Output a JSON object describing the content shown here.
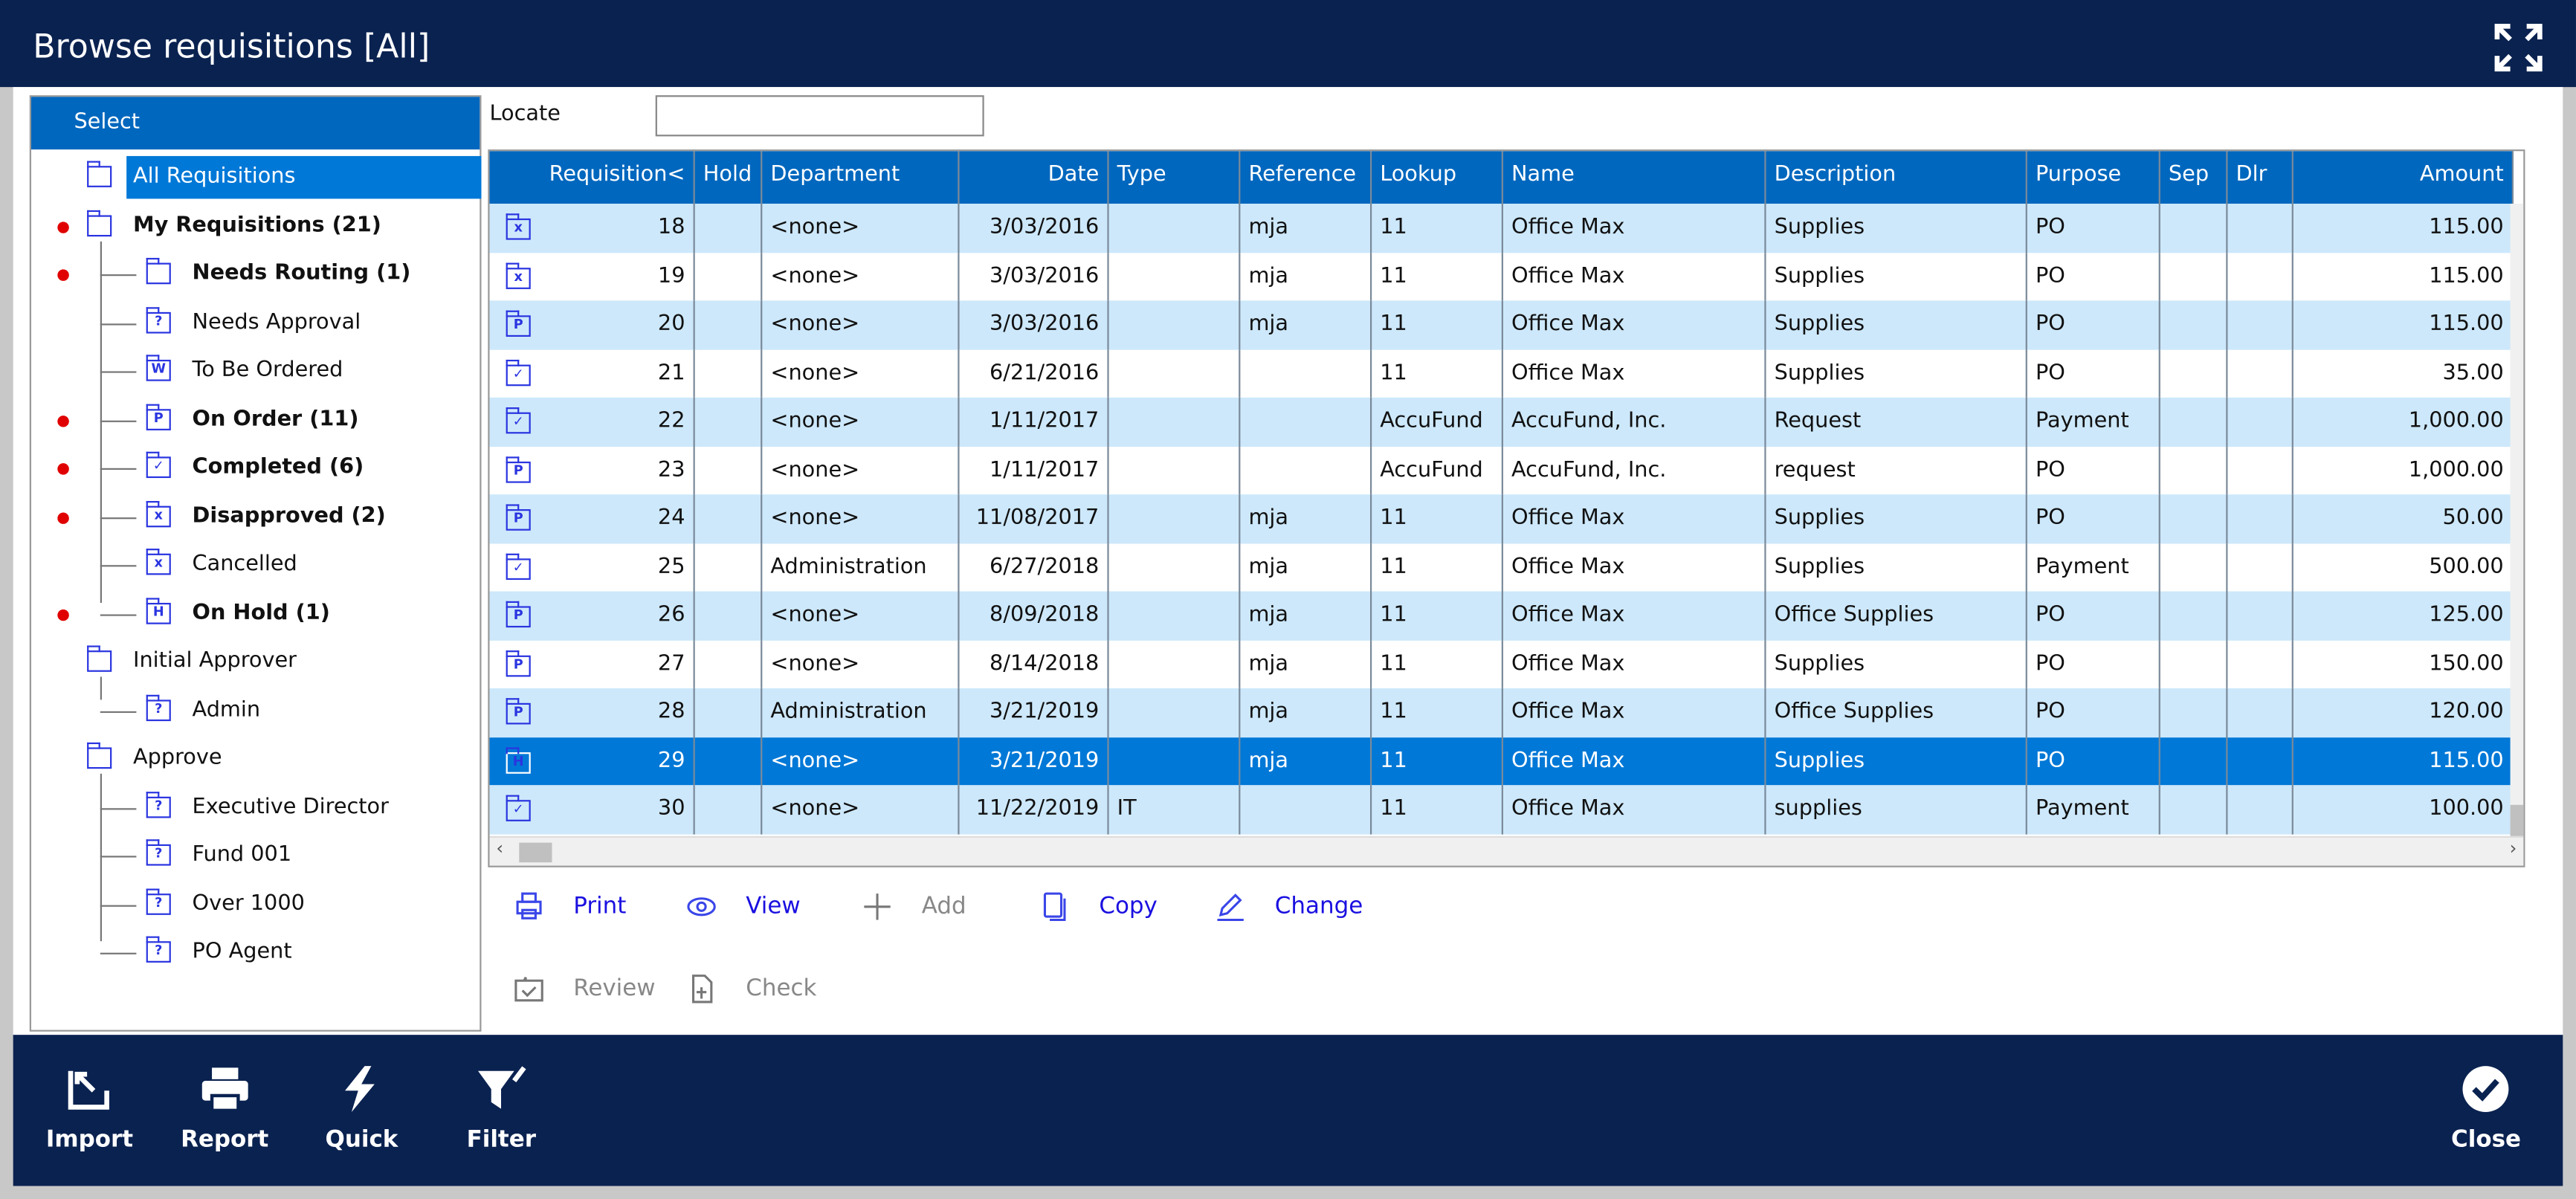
{
  "window": {
    "title": "Browse requisitions [All]"
  },
  "tree": {
    "header": "Select",
    "items": [
      {
        "label": "All Requisitions",
        "level": 0,
        "dot": false,
        "bold": false,
        "selected": true,
        "glyph": ""
      },
      {
        "label": "My Requisitions (21)",
        "level": 0,
        "dot": true,
        "bold": true,
        "glyph": ""
      },
      {
        "label": "Needs Routing (1)",
        "level": 1,
        "dot": true,
        "bold": true,
        "glyph": ""
      },
      {
        "label": "Needs Approval",
        "level": 1,
        "dot": false,
        "bold": false,
        "glyph": "?"
      },
      {
        "label": "To Be Ordered",
        "level": 1,
        "dot": false,
        "bold": false,
        "glyph": "W"
      },
      {
        "label": "On Order (11)",
        "level": 1,
        "dot": true,
        "bold": true,
        "glyph": "P"
      },
      {
        "label": "Completed (6)",
        "level": 1,
        "dot": true,
        "bold": true,
        "glyph": "✓"
      },
      {
        "label": "Disapproved (2)",
        "level": 1,
        "dot": true,
        "bold": true,
        "glyph": "x"
      },
      {
        "label": "Cancelled",
        "level": 1,
        "dot": false,
        "bold": false,
        "glyph": "x"
      },
      {
        "label": "On Hold (1)",
        "level": 1,
        "dot": true,
        "bold": true,
        "glyph": "H"
      },
      {
        "label": "Initial Approver",
        "level": 0,
        "dot": false,
        "bold": false,
        "glyph": ""
      },
      {
        "label": "Admin",
        "level": 1,
        "dot": false,
        "bold": false,
        "glyph": "?"
      },
      {
        "label": "Approve",
        "level": 0,
        "dot": false,
        "bold": false,
        "glyph": ""
      },
      {
        "label": "Executive Director",
        "level": 1,
        "dot": false,
        "bold": false,
        "glyph": "?"
      },
      {
        "label": "Fund 001",
        "level": 1,
        "dot": false,
        "bold": false,
        "glyph": "?"
      },
      {
        "label": "Over 1000",
        "level": 1,
        "dot": false,
        "bold": false,
        "glyph": "?"
      },
      {
        "label": "PO Agent",
        "level": 1,
        "dot": false,
        "bold": false,
        "glyph": "?"
      }
    ]
  },
  "locate": {
    "label": "Locate",
    "value": ""
  },
  "grid": {
    "columns": [
      "Requisition<",
      "Hold",
      "Department",
      "Date",
      "Type",
      "Reference",
      "Lookup",
      "Name",
      "Description",
      "Purpose",
      "Sep",
      "Dlr",
      "Amount"
    ],
    "rows": [
      {
        "icon": "x",
        "cells": [
          "18",
          "",
          "<none>",
          "3/03/2016",
          "",
          "mja",
          "11",
          "Office Max",
          "Supplies",
          "PO",
          "",
          "",
          "115.00"
        ]
      },
      {
        "icon": "x",
        "cells": [
          "19",
          "",
          "<none>",
          "3/03/2016",
          "",
          "mja",
          "11",
          "Office Max",
          "Supplies",
          "PO",
          "",
          "",
          "115.00"
        ]
      },
      {
        "icon": "P",
        "cells": [
          "20",
          "",
          "<none>",
          "3/03/2016",
          "",
          "mja",
          "11",
          "Office Max",
          "Supplies",
          "PO",
          "",
          "",
          "115.00"
        ]
      },
      {
        "icon": "✓",
        "cells": [
          "21",
          "",
          "<none>",
          "6/21/2016",
          "",
          "",
          "11",
          "Office Max",
          "Supplies",
          "PO",
          "",
          "",
          "35.00"
        ]
      },
      {
        "icon": "✓",
        "cells": [
          "22",
          "",
          "<none>",
          "1/11/2017",
          "",
          "",
          "AccuFund",
          "AccuFund, Inc.",
          "Request",
          "Payment",
          "",
          "",
          "1,000.00"
        ]
      },
      {
        "icon": "P",
        "cells": [
          "23",
          "",
          "<none>",
          "1/11/2017",
          "",
          "",
          "AccuFund",
          "AccuFund, Inc.",
          "request",
          "PO",
          "",
          "",
          "1,000.00"
        ]
      },
      {
        "icon": "P",
        "cells": [
          "24",
          "",
          "<none>",
          "11/08/2017",
          "",
          "mja",
          "11",
          "Office Max",
          "Supplies",
          "PO",
          "",
          "",
          "50.00"
        ]
      },
      {
        "icon": "✓",
        "cells": [
          "25",
          "",
          "Administration",
          "6/27/2018",
          "",
          "mja",
          "11",
          "Office Max",
          "Supplies",
          "Payment",
          "",
          "",
          "500.00"
        ]
      },
      {
        "icon": "P",
        "cells": [
          "26",
          "",
          "<none>",
          "8/09/2018",
          "",
          "mja",
          "11",
          "Office Max",
          "Office Supplies",
          "PO",
          "",
          "",
          "125.00"
        ]
      },
      {
        "icon": "P",
        "cells": [
          "27",
          "",
          "<none>",
          "8/14/2018",
          "",
          "mja",
          "11",
          "Office Max",
          "Supplies",
          "PO",
          "",
          "",
          "150.00"
        ]
      },
      {
        "icon": "P",
        "cells": [
          "28",
          "",
          "Administration",
          "3/21/2019",
          "",
          "mja",
          "11",
          "Office Max",
          "Office Supplies",
          "PO",
          "",
          "",
          "120.00"
        ]
      },
      {
        "icon": "H",
        "selected": true,
        "cells": [
          "29",
          "",
          "<none>",
          "3/21/2019",
          "",
          "mja",
          "11",
          "Office Max",
          "Supplies",
          "PO",
          "",
          "",
          "115.00"
        ]
      },
      {
        "icon": "✓",
        "cells": [
          "30",
          "",
          "<none>",
          "11/22/2019",
          "IT",
          "",
          "11",
          "Office Max",
          "supplies",
          "Payment",
          "",
          "",
          "100.00"
        ]
      }
    ]
  },
  "actions": [
    {
      "label": "Print",
      "icon": "printer-icon",
      "enabled": true
    },
    {
      "label": "View",
      "icon": "eye-icon",
      "enabled": true
    },
    {
      "label": "Add",
      "icon": "plus-icon",
      "enabled": false
    },
    {
      "label": "Copy",
      "icon": "copy-icon",
      "enabled": true
    },
    {
      "label": "Change",
      "icon": "pencil-icon",
      "enabled": true
    },
    {
      "label": "Review",
      "icon": "folder-check-icon",
      "enabled": false
    },
    {
      "label": "Check",
      "icon": "document-plus-icon",
      "enabled": false
    }
  ],
  "bottom": {
    "import": "Import",
    "report": "Report",
    "quick": "Quick",
    "filter": "Filter",
    "close": "Close"
  },
  "colors": {
    "titlebar": "#0a2250",
    "header": "#0067be",
    "selection": "#0078d7",
    "alt_row": "#cde8fb",
    "link": "#1a10e0",
    "dot": "#e00000"
  }
}
